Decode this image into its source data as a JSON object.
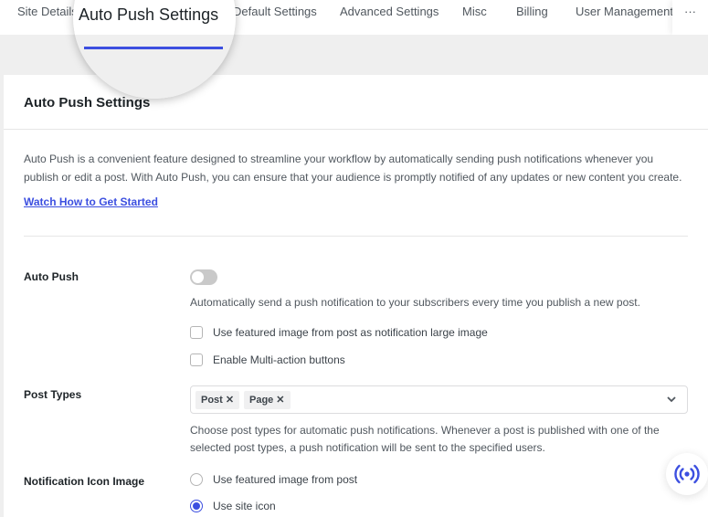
{
  "tabs": [
    {
      "label": "Site Details"
    },
    {
      "label": "Auto Push Settings",
      "active": true
    },
    {
      "label": "Default Settings"
    },
    {
      "label": "Advanced Settings"
    },
    {
      "label": "Misc"
    },
    {
      "label": "Billing"
    },
    {
      "label": "User Management"
    }
  ],
  "more_label": "···",
  "card": {
    "title": "Auto Push Settings",
    "description": "Auto Push is a convenient feature designed to streamline your workflow by automatically sending push notifications whenever you publish or edit a post. With Auto Push, you can ensure that your audience is promptly notified of any updates or new content you create.",
    "watch_link": "Watch How to Get Started"
  },
  "auto_push": {
    "label": "Auto Push",
    "enabled": false,
    "help": "Automatically send a push notification to your subscribers every time you publish a new post.",
    "options": [
      {
        "label": "Use featured image from post as notification large image",
        "checked": false
      },
      {
        "label": "Enable Multi-action buttons",
        "checked": false
      }
    ]
  },
  "post_types": {
    "label": "Post Types",
    "selected": [
      {
        "label": "Post",
        "remove": "✕"
      },
      {
        "label": "Page",
        "remove": "✕"
      }
    ],
    "help_line1": "Choose post types for automatic push notifications. Whenever a post is published with one of the",
    "help_line2": "selected post types, a push notification will be sent to the specified users."
  },
  "notification_icon": {
    "label": "Notification Icon Image",
    "options": [
      {
        "label": "Use featured image from post",
        "selected": false
      },
      {
        "label": "Use site icon",
        "selected": true
      }
    ]
  },
  "colors": {
    "accent": "#3c4fe0"
  }
}
